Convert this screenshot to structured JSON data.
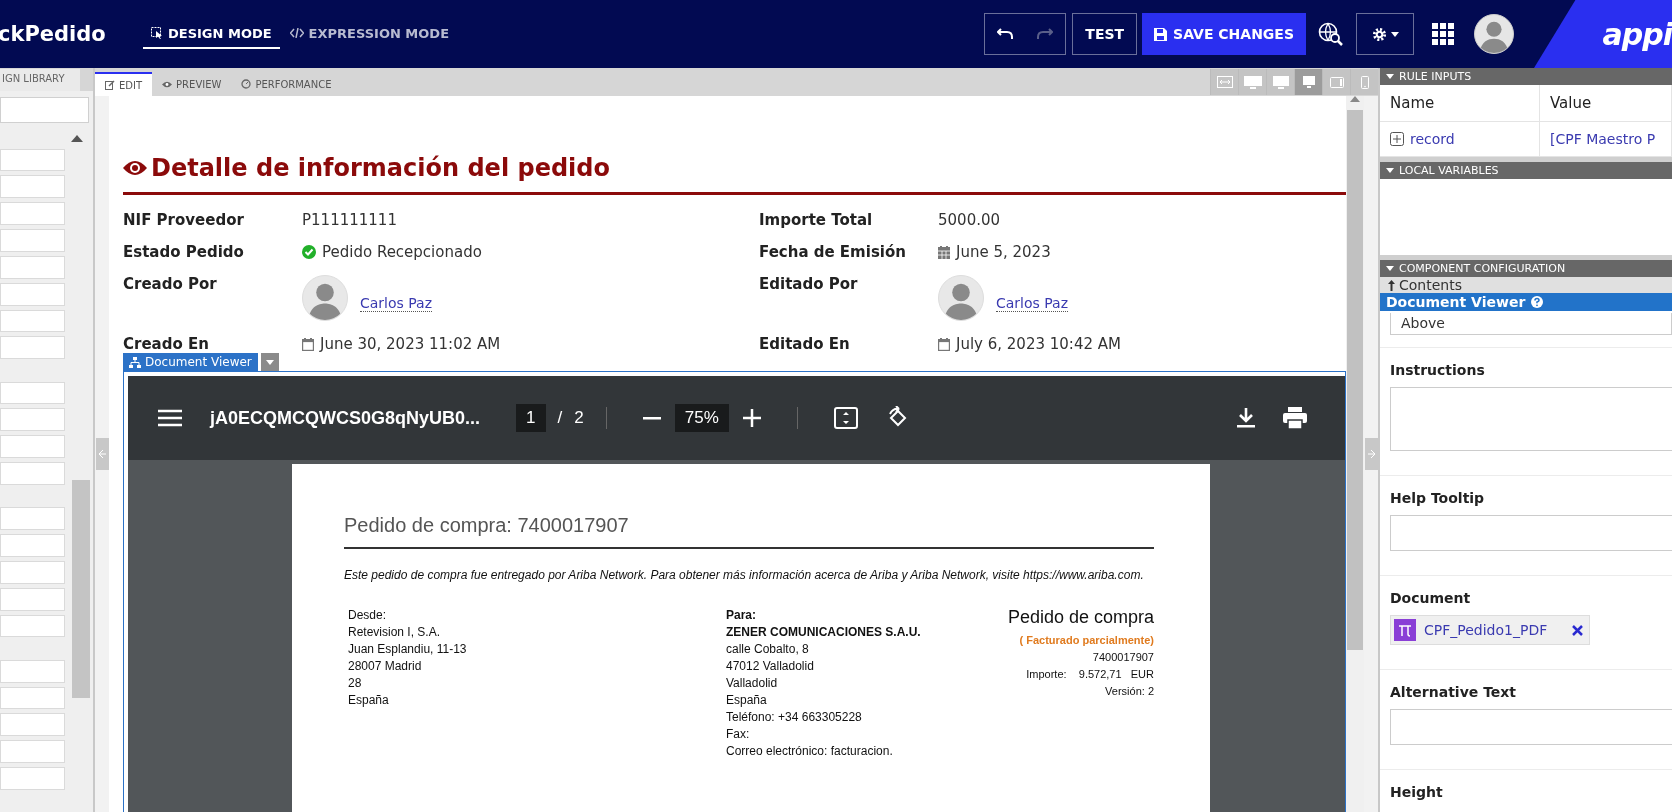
{
  "header": {
    "app_title": "ckPedido",
    "modes": [
      {
        "label": "DESIGN MODE",
        "kind": "design",
        "selected": true
      },
      {
        "label": "EXPRESSION MODE",
        "kind": "expression",
        "selected": false
      }
    ],
    "undo": {
      "disabled": false
    },
    "redo": {
      "disabled": true
    },
    "test_button": "TEST",
    "save_button": "SAVE CHANGES",
    "logo": "appi"
  },
  "left_panel": {
    "tab": "IGN LIBRARY"
  },
  "editor_tabs": [
    {
      "label": "EDIT",
      "kind": "edit",
      "selected": true
    },
    {
      "label": "PREVIEW",
      "kind": "preview",
      "selected": false
    },
    {
      "label": "PERFORMANCE",
      "kind": "performance",
      "selected": false
    }
  ],
  "device_buttons": [
    {
      "kind": "fit",
      "selected": false
    },
    {
      "kind": "wide",
      "selected": false
    },
    {
      "kind": "desktop",
      "selected": false
    },
    {
      "kind": "small",
      "selected": true
    },
    {
      "kind": "tablet",
      "selected": false
    },
    {
      "kind": "phone",
      "selected": false
    }
  ],
  "form": {
    "title": "Detalle de información del pedido",
    "fields": [
      {
        "label": "NIF Proveedor",
        "kind": "text",
        "value": "P111111111"
      },
      {
        "label": "Importe Total",
        "kind": "text",
        "value": "5000.00"
      },
      {
        "label": "Estado Pedido",
        "kind": "status",
        "value": "Pedido Recepcionado"
      },
      {
        "label": "Fecha de Emisión",
        "kind": "date",
        "value": "June 5, 2023"
      },
      {
        "label": "Creado Por",
        "kind": "user",
        "value": "Carlos Paz"
      },
      {
        "label": "Editado Por",
        "kind": "user",
        "value": "Carlos Paz"
      },
      {
        "label": "Creado En",
        "kind": "datetime",
        "value": "June 30, 2023 11:02 AM"
      },
      {
        "label": "Editado En",
        "kind": "datetime",
        "value": "July 6, 2023 10:42 AM"
      }
    ]
  },
  "document_viewer": {
    "label": "Document Viewer",
    "toolbar": {
      "file_name": "jA0ECQMCQWCS0G8qNyUB0...",
      "page": "1",
      "page_separator": "/",
      "page_count": "2",
      "zoom": "75%"
    },
    "page": {
      "heading": "Pedido de compra: 7400017907",
      "note": "Este pedido de compra fue entregado por Ariba Network.   Para obtener más información acerca de Ariba y Ariba Network, visite https://www.ariba.com.",
      "from_lines": [
        "Desde:",
        "Retevision I, S.A.",
        "Juan Esplandiu, 11-13",
        "28007 Madrid",
        "28",
        "España"
      ],
      "to_title": "Para:",
      "to_company": "ZENER COMUNICACIONES S.A.U.",
      "to_lines": [
        "calle Cobalto, 8",
        "47012 Valladolid",
        "Valladolid",
        "España",
        "Teléfono: +34 663305228",
        "Fax:",
        "Correo electrónico: facturacion."
      ],
      "order_title": "Pedido de compra",
      "order_status": "( Facturado parcialmente)",
      "order_lines": [
        "7400017907",
        "Importe:    9.572,71   EUR",
        "Versión: 2"
      ]
    }
  },
  "right_panel": {
    "rule_inputs": {
      "title": "RULE INPUTS",
      "columns": [
        "Name",
        "Value"
      ],
      "rows": [
        {
          "name": "record",
          "value": "[CPF Maestro P"
        }
      ]
    },
    "local_variables": {
      "title": "LOCAL VARIABLES"
    },
    "component_configuration": {
      "title": "COMPONENT CONFIGURATION",
      "breadcrumb": "Contents",
      "component": "Document Viewer",
      "label_position": "Above",
      "fields": [
        {
          "label": "Instructions",
          "kind": "textarea"
        },
        {
          "label": "Help Tooltip",
          "kind": "input"
        },
        {
          "label": "Document",
          "kind": "token",
          "value": "CPF_Pedido1_PDF"
        },
        {
          "label": "Alternative Text",
          "kind": "input"
        },
        {
          "label": "Height",
          "kind": "cut"
        }
      ]
    }
  }
}
